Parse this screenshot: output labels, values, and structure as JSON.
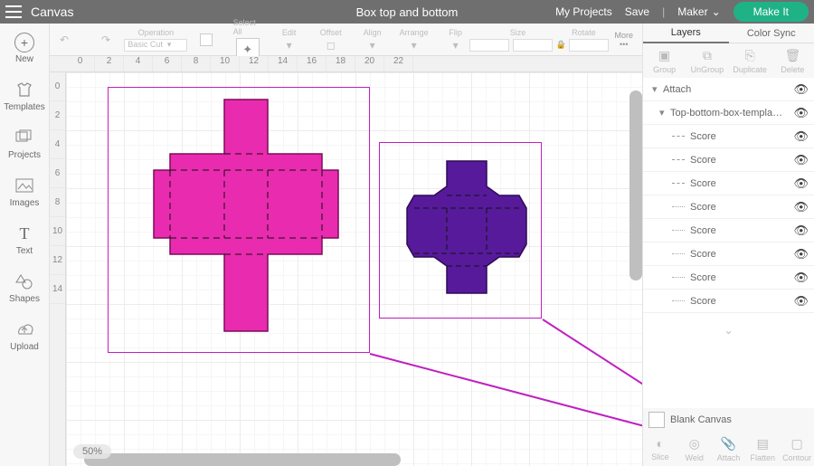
{
  "app_name": "Canvas",
  "project_title": "Box top and bottom",
  "top_links": {
    "myprojects": "My Projects",
    "save": "Save"
  },
  "machine": {
    "name": "Maker"
  },
  "make_it": "Make It",
  "toolbar": {
    "operation_label": "Operation",
    "operation_value": "Basic Cut",
    "selectall": "Select All",
    "edit": "Edit",
    "offset": "Offset",
    "align": "Align",
    "arrange": "Arrange",
    "flip": "Flip",
    "size": "Size",
    "rotate": "Rotate",
    "more": "More"
  },
  "leftrail": [
    {
      "key": "new",
      "label": "New"
    },
    {
      "key": "templates",
      "label": "Templates"
    },
    {
      "key": "projects",
      "label": "Projects"
    },
    {
      "key": "images",
      "label": "Images"
    },
    {
      "key": "text",
      "label": "Text"
    },
    {
      "key": "shapes",
      "label": "Shapes"
    },
    {
      "key": "upload",
      "label": "Upload"
    }
  ],
  "ruler_h": [
    "0",
    "2",
    "4",
    "6",
    "8",
    "10",
    "12",
    "14",
    "16",
    "18",
    "20",
    "22"
  ],
  "ruler_v": [
    "0",
    "2",
    "4",
    "6",
    "8",
    "10",
    "12",
    "14"
  ],
  "zoom": "50%",
  "right": {
    "tabs": {
      "layers": "Layers",
      "colorsync": "Color Sync"
    },
    "iconrow": {
      "group": "Group",
      "ungroup": "UnGroup",
      "duplicate": "Duplicate",
      "delete": "Delete"
    },
    "attach": "Attach",
    "group_name": "Top-bottom-box-templa…",
    "children": [
      {
        "label": "Score",
        "style": "dash"
      },
      {
        "label": "Score",
        "style": "dash"
      },
      {
        "label": "Score",
        "style": "dash"
      },
      {
        "label": "Score",
        "style": "dot"
      },
      {
        "label": "Score",
        "style": "dot"
      },
      {
        "label": "Score",
        "style": "dot"
      },
      {
        "label": "Score",
        "style": "dot"
      },
      {
        "label": "Score",
        "style": "dot"
      }
    ],
    "blank_canvas": "Blank Canvas",
    "bottom": {
      "slice": "Slice",
      "weld": "Weld",
      "attach": "Attach",
      "flatten": "Flatten",
      "contour": "Contour"
    }
  }
}
